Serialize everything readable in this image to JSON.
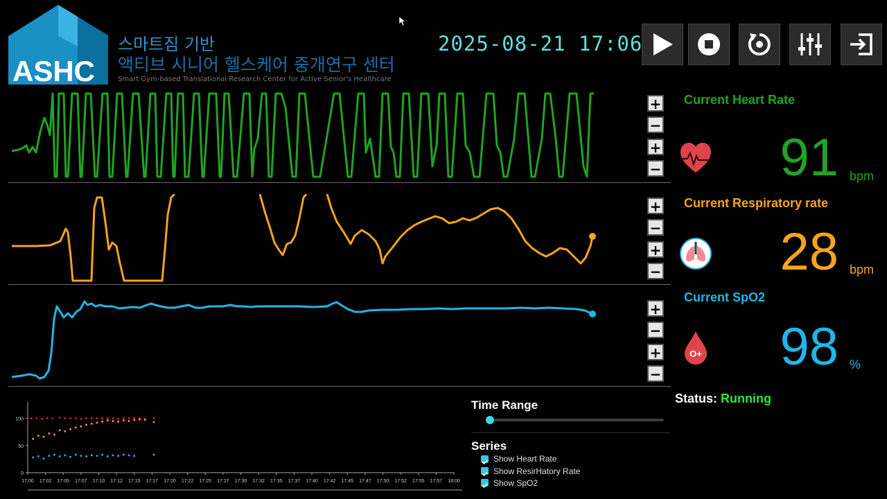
{
  "header": {
    "logo_text": "ASHC",
    "title_line1": "스마트짐 기반",
    "title_line2": "액티브 시니어 헬스케어 중개연구 센터",
    "title_en": "Smart Gym-based Translational Research Center for Active Senior's Healthcare",
    "datetime": "2025-08-21  17:06"
  },
  "toolbar": {
    "buttons": [
      "play",
      "stop",
      "reset",
      "settings",
      "exit"
    ]
  },
  "zoom": {
    "plus": "+",
    "minus": "−"
  },
  "colors": {
    "heart": "#22a322",
    "resp": "#f5a51c",
    "spo2": "#21b6e8",
    "running": "#33e233"
  },
  "vitals": {
    "heart": {
      "label": "Current Heart Rate",
      "value": "91",
      "unit": "bpm",
      "icon": "heart-monitor-icon"
    },
    "resp": {
      "label": "Current Respiratory rate",
      "value": "28",
      "unit": "bpm",
      "icon": "lungs-icon"
    },
    "spo2": {
      "label": "Current SpO2",
      "value": "98",
      "unit": "%",
      "icon": "blood-drop-icon"
    }
  },
  "status": {
    "label": "Status:",
    "value": "Running"
  },
  "controls": {
    "time_range_label": "Time Range",
    "time_range_value": 0,
    "series_label": "Series",
    "series": [
      {
        "label": "Show Heart Rate",
        "checked": true
      },
      {
        "label": "Show ResirHatory Rate",
        "checked": true
      },
      {
        "label": "Show SpO2",
        "checked": true
      }
    ]
  },
  "chart_data": {
    "type": "scatter",
    "y_ticks": [
      "0",
      "50",
      "100"
    ],
    "ylim": [
      0,
      130
    ],
    "x_ticks": [
      "17:00",
      "17:02",
      "17:05",
      "17:07",
      "17:10",
      "17:12",
      "17:15",
      "17:17",
      "17:20",
      "17:22",
      "17:25",
      "17:27",
      "17:30",
      "17:32",
      "17:35",
      "17:37",
      "17:40",
      "17:42",
      "17:45",
      "17:47",
      "17:50",
      "17:52",
      "17:55",
      "17:57",
      "18:00"
    ],
    "series": [
      {
        "color": "#e02020",
        "points": [
          [
            0.2,
            100
          ],
          [
            0.5,
            100
          ],
          [
            0.8,
            99
          ],
          [
            1.1,
            100
          ],
          [
            1.4,
            100
          ],
          [
            1.8,
            101
          ],
          [
            2.1,
            100
          ],
          [
            2.4,
            100
          ],
          [
            2.7,
            100
          ],
          [
            3.0,
            99
          ],
          [
            3.3,
            100
          ],
          [
            3.6,
            100
          ],
          [
            3.9,
            100
          ],
          [
            4.2,
            100
          ],
          [
            4.5,
            100
          ],
          [
            4.8,
            100
          ],
          [
            5.1,
            99
          ],
          [
            5.4,
            100
          ],
          [
            5.7,
            100
          ],
          [
            6.0,
            100
          ],
          [
            6.3,
            100
          ],
          [
            6.6,
            99
          ],
          [
            7.1,
            100
          ]
        ]
      },
      {
        "color": "#f5a51c",
        "points": [
          [
            0.3,
            62
          ],
          [
            0.6,
            68
          ],
          [
            0.9,
            66
          ],
          [
            1.2,
            72
          ],
          [
            1.5,
            70
          ],
          [
            1.8,
            78
          ],
          [
            2.1,
            76
          ],
          [
            2.4,
            80
          ],
          [
            2.7,
            83
          ],
          [
            3.0,
            85
          ],
          [
            3.3,
            88
          ],
          [
            3.6,
            90
          ],
          [
            3.9,
            92
          ],
          [
            4.2,
            94
          ],
          [
            4.5,
            96
          ],
          [
            4.8,
            95
          ],
          [
            5.1,
            94
          ],
          [
            5.4,
            96
          ],
          [
            5.7,
            95
          ],
          [
            6.0,
            97
          ],
          [
            6.3,
            98
          ],
          [
            6.6,
            97
          ],
          [
            7.1,
            93
          ]
        ]
      },
      {
        "color": "#21b6e8",
        "points": [
          [
            0.3,
            28
          ],
          [
            0.6,
            30
          ],
          [
            0.9,
            26
          ],
          [
            1.2,
            31
          ],
          [
            1.5,
            33
          ],
          [
            1.8,
            30
          ],
          [
            2.1,
            32
          ],
          [
            2.4,
            29
          ],
          [
            2.7,
            33
          ],
          [
            3.0,
            31
          ],
          [
            3.3,
            30
          ],
          [
            3.6,
            32
          ],
          [
            3.9,
            31
          ],
          [
            4.2,
            33
          ],
          [
            4.5,
            30
          ],
          [
            4.8,
            32
          ],
          [
            5.1,
            31
          ],
          [
            5.4,
            33
          ],
          [
            5.7,
            32
          ],
          [
            6.0,
            31
          ],
          [
            7.1,
            33
          ]
        ]
      }
    ]
  }
}
